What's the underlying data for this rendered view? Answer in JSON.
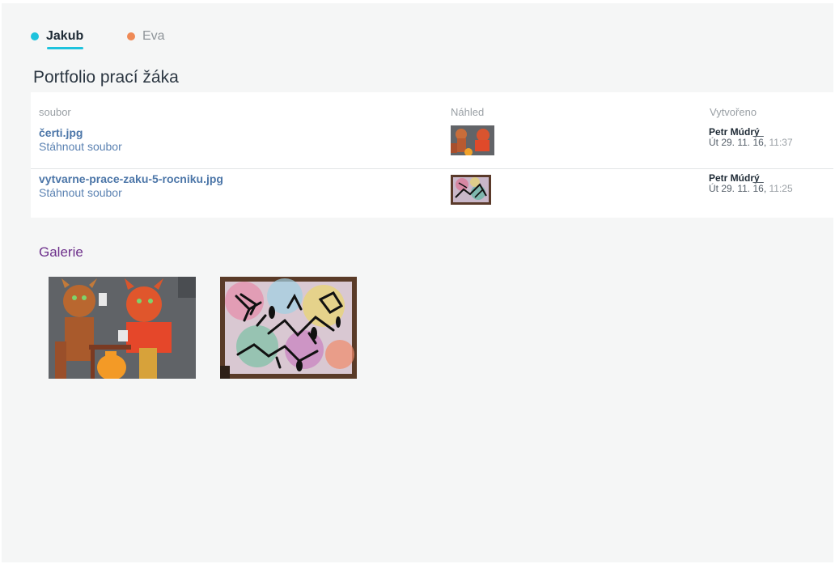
{
  "tabs": [
    {
      "label": "Jakub",
      "color": "#1ec3dd",
      "active": true
    },
    {
      "label": "Eva",
      "color": "#ef8a56",
      "active": false
    }
  ],
  "portfolio": {
    "title": "Portfolio prací žáka",
    "columns": {
      "file": "soubor",
      "preview": "Náhled",
      "created": "Vytvořeno"
    },
    "files": [
      {
        "name": "čerti.jpg",
        "download_label": "Stáhnout soubor",
        "author": "Petr Múdrý",
        "date_prefix": "Út 29. 11. ",
        "date_year": "16",
        "date_sep": ", ",
        "time": "11:37"
      },
      {
        "name": "vytvarne-prace-zaku-5-rocniku.jpg",
        "download_label": "Stáhnout soubor",
        "author": "Petr Múdrý",
        "date_prefix": "Út 29. 11. ",
        "date_year": "16",
        "date_sep": ", ",
        "time": "11:25"
      }
    ]
  },
  "gallery": {
    "title": "Galerie"
  },
  "colors": {
    "accent_jakub": "#1ec3dd",
    "accent_eva": "#ef8a56",
    "link": "#4c76a8",
    "gallery_title": "#6d2f8b"
  }
}
